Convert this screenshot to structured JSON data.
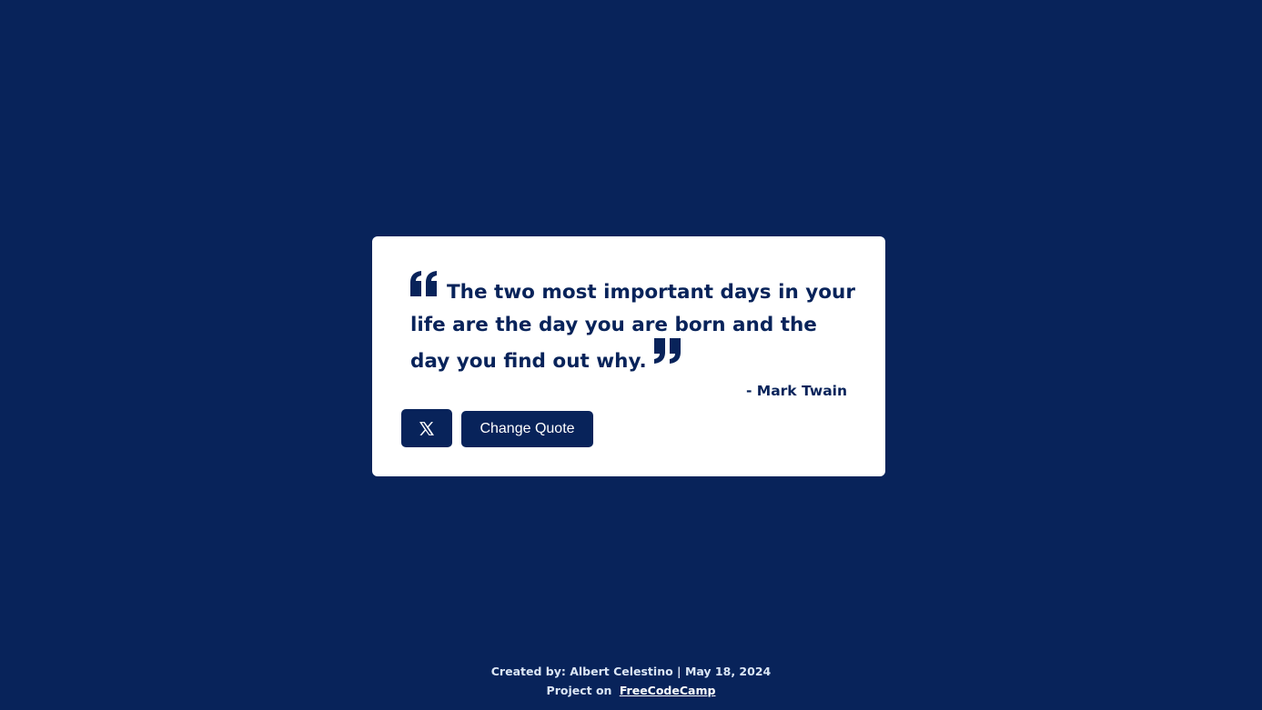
{
  "colors": {
    "background": "#08235a",
    "card": "#ffffff",
    "accent": "#08235a"
  },
  "quote": {
    "open_icon": "quote-left-icon",
    "text": "The two most important days in your life are the day you are born and the day you find out why.",
    "close_icon": "quote-right-icon",
    "author": "- Mark Twain"
  },
  "actions": {
    "tweet_icon": "x-logo-icon",
    "change_label": "Change Quote"
  },
  "footer": {
    "credit": "Created by: Albert Celestino | May 18, 2024",
    "project_prefix": "Project on",
    "project_link": "FreeCodeCamp"
  }
}
